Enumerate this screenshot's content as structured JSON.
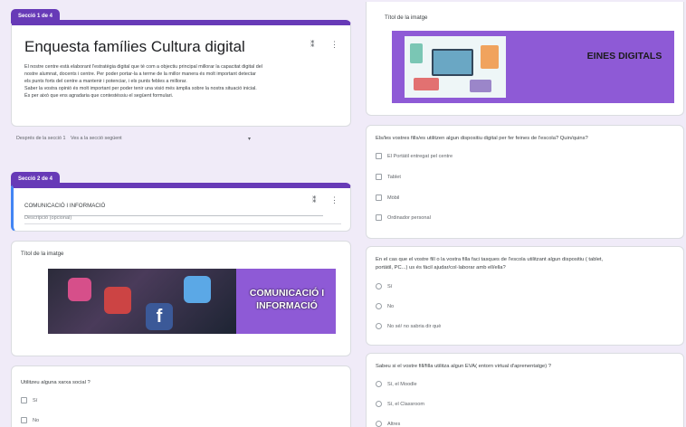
{
  "section1": {
    "tab": "Secció 1 de 4",
    "title": "Enquesta famílies Cultura digital",
    "description_lines": [
      "El nostre centre està elaborant l'estratègia digital que té com a objectiu principal millorar la capacitat digital del",
      "nostre alumnat, docents i centre. Per poder portar-la a terme de la millor manera és molt important detectar",
      "els punts forts del centre a mantenir i potenciar, i els punts febles a millorar.",
      "Saber la vostra opinió és molt important per poder tenir una visió més àmplia sobre la nostra situació inicial.",
      "És per això que ens agradaria que contestéssiu el següent formulari."
    ]
  },
  "after_section": {
    "label": "Després de la secció 1",
    "value": "Ves a la secció següent"
  },
  "section2": {
    "tab": "Secció 2 de 4",
    "title": "COMUNICACIÓ I INFORMACIÓ",
    "description_placeholder": "Descripció (opcional)"
  },
  "image_card_left": {
    "title": "Títol de la imatge",
    "banner_text": "COMUNICACIÓ I INFORMACIÓ"
  },
  "question_social": {
    "text": "Utilitzeu alguna xarxa social ?",
    "options": [
      "Sí",
      "No"
    ]
  },
  "image_card_right": {
    "title": "Títol de la imatge",
    "banner_text": "EINES DIGITALS"
  },
  "question_devices": {
    "text": "Els/les vostres fills/es utilitzen algun dispositiu digital per fer feines de l'escola? Quin/quins?",
    "options": [
      "El Portàtil entregat pel centre",
      "Tablet",
      "Mòbil",
      "Ordinador personal"
    ]
  },
  "question_help": {
    "text_lines": [
      "En el cas que el vostre fill o la vostra filla faci tasques de l'escola utilitzant algun dispositiu ( tablet,",
      "portàtil, PC...) us és fàcil ajudar/col·laborar amb ell/ella?"
    ],
    "options": [
      "Sí",
      "No",
      "No sé/ no sabria dir què"
    ]
  },
  "question_eva": {
    "text": "Sabeu si el vostre fill/filla utilitza algun EVA( entorn virtual d'aprenentatge) ?",
    "options": [
      "Sí, el Moodle",
      "Sí, el Classroom",
      "Altres"
    ]
  },
  "colors": {
    "accent": "#673ab7",
    "background": "#f0ebf8",
    "banner": "#8e5ad6"
  },
  "icons": {
    "kebab": "more-vert-icon",
    "drag": "drag-indicator-icon"
  }
}
